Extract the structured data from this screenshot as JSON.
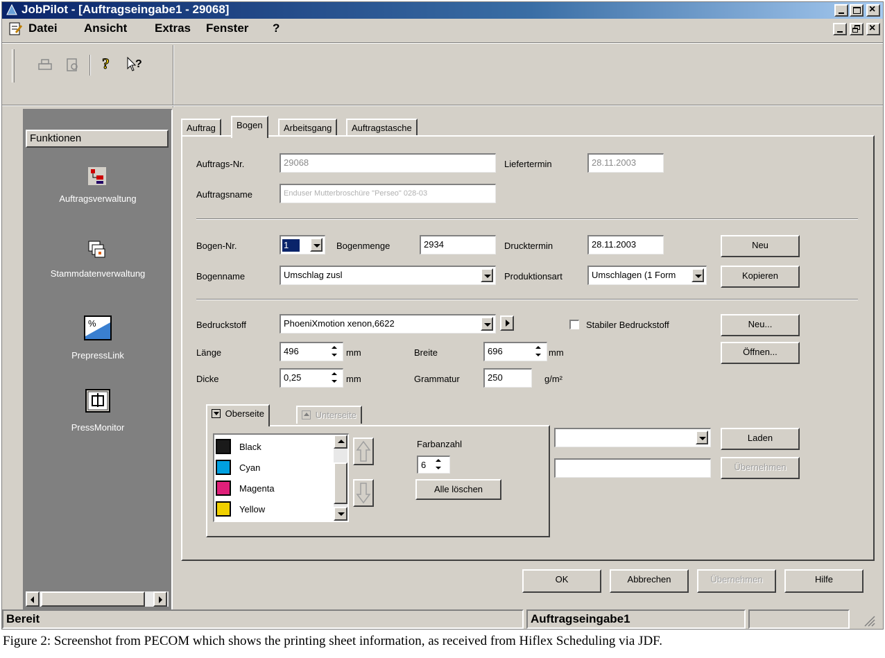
{
  "window": {
    "title": "JobPilot - [Auftragseingabe1 - 29068]"
  },
  "menu": [
    "Datei",
    "Ansicht",
    "Extras",
    "Fenster",
    "?"
  ],
  "sidebar": {
    "header": "Funktionen",
    "items": [
      {
        "label": "Auftragsverwaltung",
        "icon": "order-management-icon"
      },
      {
        "label": "Stammdatenverwaltung",
        "icon": "master-data-icon"
      },
      {
        "label": "PrepressLink",
        "icon": "prepress-link-icon"
      },
      {
        "label": "PressMonitor",
        "icon": "press-monitor-icon"
      }
    ]
  },
  "tabs": [
    "Auftrag",
    "Bogen",
    "Arbeitsgang",
    "Auftragstasche"
  ],
  "active_tab": "Bogen",
  "order": {
    "nr_label": "Auftrags-Nr.",
    "nr_value": "29068",
    "delivery_label": "Liefertermin",
    "delivery_value": "28.11.2003",
    "name_label": "Auftragsname",
    "name_value": "Enduser Mutterbroschüre \"Perseo\" 028-03"
  },
  "sheet": {
    "nr_label": "Bogen-Nr.",
    "nr_value": "1",
    "qty_label": "Bogenmenge",
    "qty_value": "2934",
    "print_date_label": "Drucktermin",
    "print_date_value": "28.11.2003",
    "name_label": "Bogenname",
    "name_value": "Umschlag zusl",
    "prod_label": "Produktionsart",
    "prod_value": "Umschlagen (1 Form",
    "new_button": "Neu",
    "copy_button": "Kopieren"
  },
  "stock": {
    "label": "Bedruckstoff",
    "value": "PhoeniXmotion xenon,6622",
    "stable_label": "Stabiler Bedruckstoff",
    "stable_checked": false,
    "length_label": "Länge",
    "length_value": "496",
    "length_unit": "mm",
    "width_label": "Breite",
    "width_value": "696",
    "width_unit": "mm",
    "thickness_label": "Dicke",
    "thickness_value": "0,25",
    "thickness_unit": "mm",
    "grammage_label": "Grammatur",
    "grammage_value": "250",
    "grammage_unit": "g/m²",
    "new_button": "Neu...",
    "open_button": "Öffnen..."
  },
  "colors": {
    "tab_front": "Oberseite",
    "tab_back": "Unterseite",
    "inks": [
      {
        "name": "Black",
        "color": "#1a1a1a"
      },
      {
        "name": "Cyan",
        "color": "#00a0e0"
      },
      {
        "name": "Magenta",
        "color": "#e0207a"
      },
      {
        "name": "Yellow",
        "color": "#f0d000"
      }
    ],
    "count_label": "Farbanzahl",
    "count_value": "6",
    "clear_button": "Alle löschen",
    "load_button": "Laden",
    "apply_button": "Übernehmen"
  },
  "footer_buttons": {
    "ok": "OK",
    "cancel": "Abbrechen",
    "apply": "Übernehmen",
    "help": "Hilfe"
  },
  "status": {
    "left": "Bereit",
    "middle": "Auftragseingabe1"
  },
  "caption": "Figure 2: Screenshot from PECOM which shows the printing sheet information, as received from Hiflex Scheduling via JDF."
}
